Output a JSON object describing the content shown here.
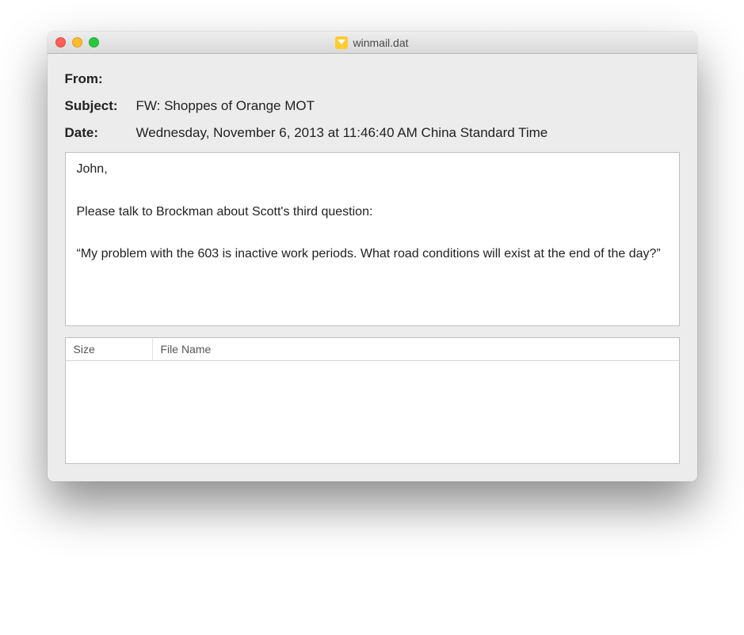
{
  "window": {
    "title": "winmail.dat"
  },
  "meta": {
    "from_label": "From:",
    "from_value": "",
    "subject_label": "Subject:",
    "subject_value": "FW: Shoppes of Orange MOT",
    "date_label": "Date:",
    "date_value": "Wednesday, November 6, 2013 at 11:46:40 AM China Standard Time"
  },
  "body": {
    "p1": "John,",
    "p2": "Please talk to Brockman about Scott's third question:",
    "p3": "“My problem with the 603 is inactive work periods. What road conditions will exist at the end of the day?”"
  },
  "attachments": {
    "col_size": "Size",
    "col_name": "File Name"
  }
}
